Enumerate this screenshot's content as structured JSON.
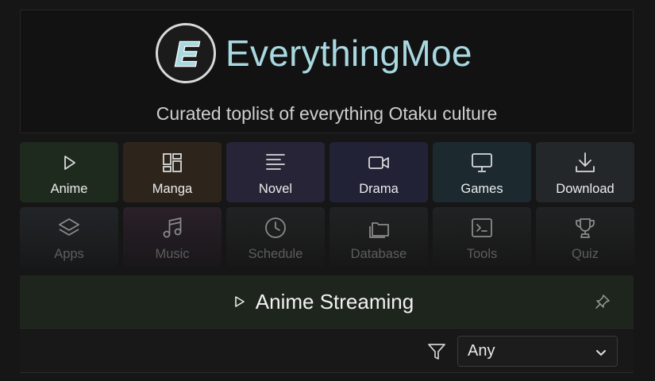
{
  "header": {
    "logo_letter": "E",
    "site_title": "EverythingMoe",
    "tagline": "Curated toplist of everything Otaku culture"
  },
  "categories": [
    {
      "label": "Anime",
      "icon": "play-icon"
    },
    {
      "label": "Manga",
      "icon": "layout-icon"
    },
    {
      "label": "Novel",
      "icon": "text-lines-icon"
    },
    {
      "label": "Drama",
      "icon": "video-camera-icon"
    },
    {
      "label": "Games",
      "icon": "monitor-icon"
    },
    {
      "label": "Download",
      "icon": "download-icon"
    },
    {
      "label": "Apps",
      "icon": "layers-icon"
    },
    {
      "label": "Music",
      "icon": "music-note-icon"
    },
    {
      "label": "Schedule",
      "icon": "clock-icon"
    },
    {
      "label": "Database",
      "icon": "folders-icon"
    },
    {
      "label": "Tools",
      "icon": "terminal-icon"
    },
    {
      "label": "Quiz",
      "icon": "trophy-icon"
    }
  ],
  "section": {
    "title": "Anime Streaming",
    "icon": "play-icon",
    "pin_icon": "pin-icon"
  },
  "filter": {
    "icon": "filter-icon",
    "selected": "Any"
  },
  "colors": {
    "background": "#161616",
    "title_accent": "#a8d8e0",
    "section_bar": "#1d251c"
  }
}
